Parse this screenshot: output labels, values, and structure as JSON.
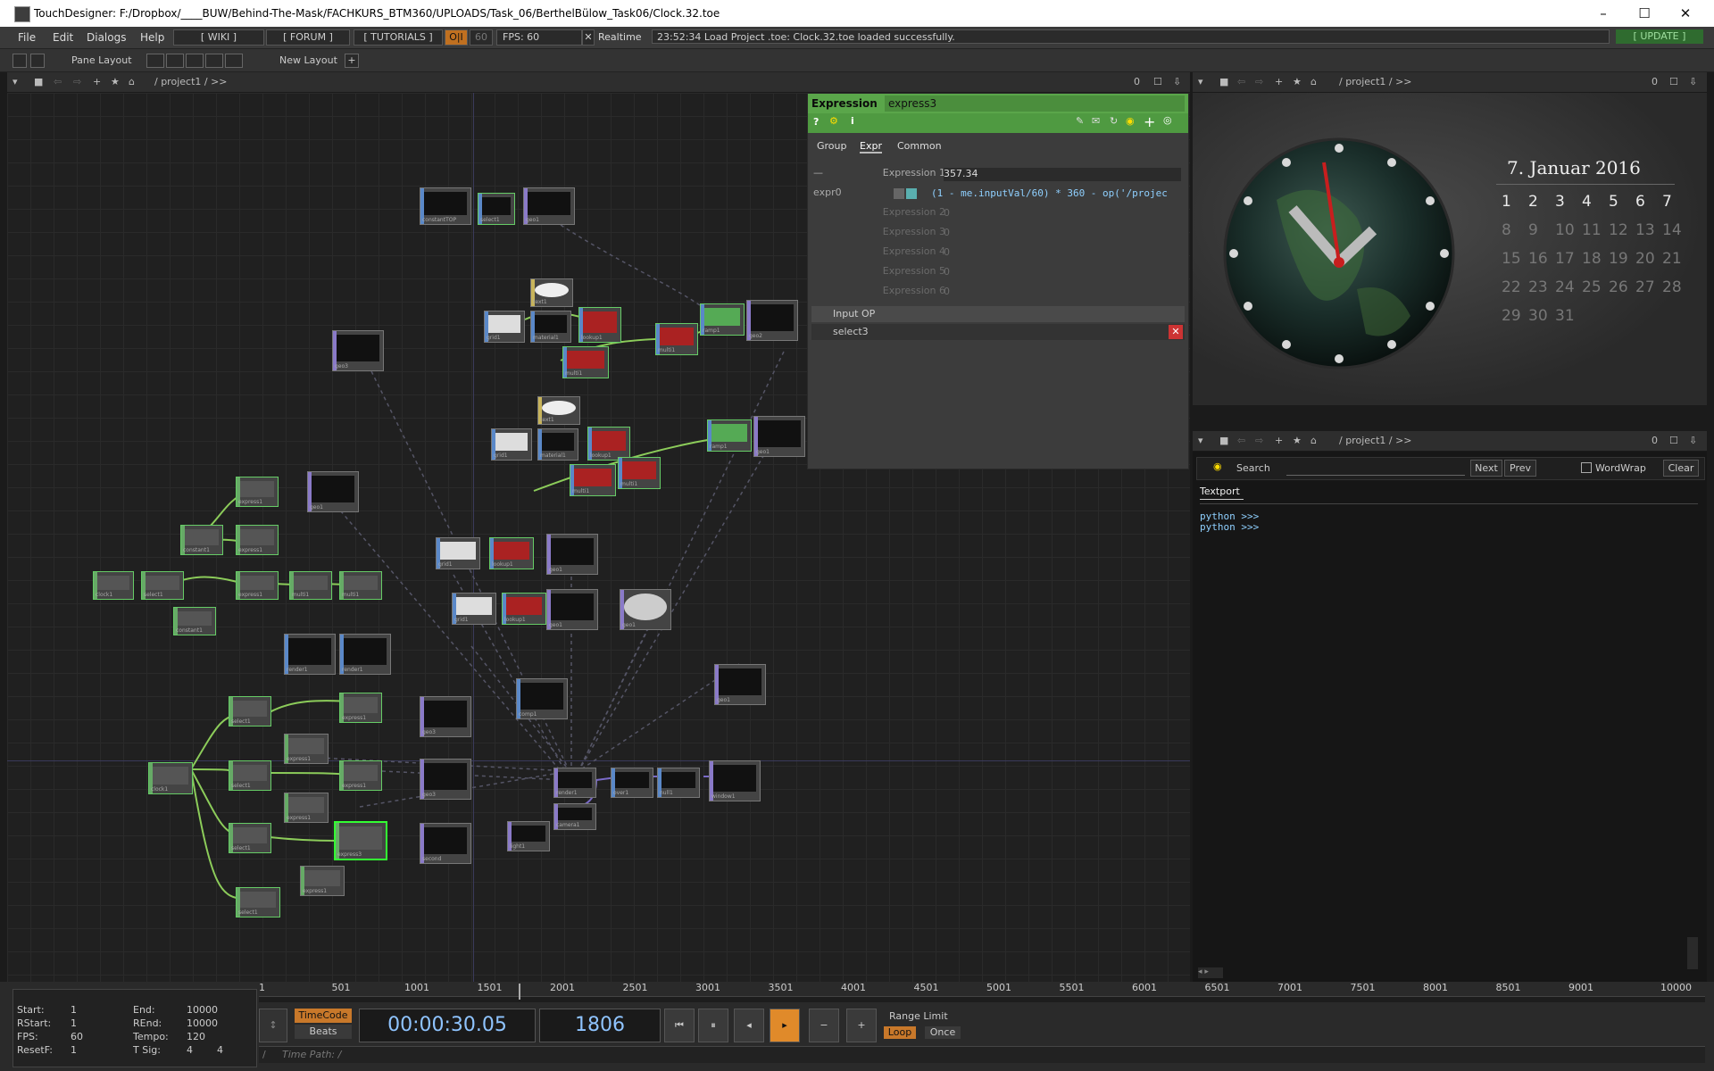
{
  "window": {
    "title": "TouchDesigner: F:/Dropbox/____BUW/Behind-The-Mask/FACHKURS_BTM360/UPLOADS/Task_06/BerthelBülow_Task06/Clock.32.toe",
    "minimize": "–",
    "maximize": "☐",
    "close": "✕"
  },
  "menu": {
    "items": [
      "File",
      "Edit",
      "Dialogs",
      "Help"
    ],
    "wiki": "[ WIKI ]",
    "forum": "[ FORUM ]",
    "tutorials": "[ TUTORIALS ]",
    "oi": "O|I",
    "fps_cap": "60",
    "fps": "FPS:  60",
    "realtime": "Realtime",
    "status": "23:52:34 Load Project .toe: Clock.32.toe loaded successfully.",
    "update": "[ UPDATE ]"
  },
  "layoutbar": {
    "pane_layout": "Pane Layout",
    "new_layout": "New Layout"
  },
  "network_path": {
    "path": "/ project1 / >>",
    "zero": "0"
  },
  "viewer_path": {
    "path": "/ project1 / >>",
    "zero": "0"
  },
  "textport_path": {
    "path": "/ project1 / >>",
    "zero": "0"
  },
  "params": {
    "type": "Expression",
    "name": "express3",
    "tabs": [
      "Group",
      "Expr",
      "Common"
    ],
    "rows": [
      {
        "label": "Expression 1",
        "value": "357.34"
      },
      {
        "label": "expr0",
        "value": "(1 - me.inputVal/60) * 360 - op('/projec"
      },
      {
        "label": "Expression 2",
        "value": "0"
      },
      {
        "label": "Expression 3",
        "value": "0"
      },
      {
        "label": "Expression 4",
        "value": "0"
      },
      {
        "label": "Expression 5",
        "value": "0"
      },
      {
        "label": "Expression 6",
        "value": "0"
      }
    ],
    "input_op_label": "Input OP",
    "input_op_value": "select3"
  },
  "calendar": {
    "title": "7. Januar 2016",
    "rows": [
      [
        "1",
        "2",
        "3",
        "4",
        "5",
        "6",
        "7"
      ],
      [
        "8",
        "9",
        "10",
        "11",
        "12",
        "13",
        "14"
      ],
      [
        "15",
        "16",
        "17",
        "18",
        "19",
        "20",
        "21"
      ],
      [
        "22",
        "23",
        "24",
        "25",
        "26",
        "27",
        "28"
      ],
      [
        "29",
        "30",
        "31"
      ]
    ]
  },
  "textport": {
    "search_label": "Search",
    "next": "Next",
    "prev": "Prev",
    "wordwrap": "WordWrap",
    "clear": "Clear",
    "tab": "Textport",
    "lines": [
      "python >>>",
      "python >>>"
    ]
  },
  "timeline": {
    "ticks": [
      "1",
      "501",
      "1001",
      "1501",
      "2001",
      "2501",
      "3001",
      "3501",
      "4001",
      "4501",
      "5001",
      "5501",
      "6001",
      "6501",
      "7001",
      "7501",
      "8001",
      "8501",
      "9001",
      "10000"
    ],
    "info": {
      "start_label": "Start:",
      "start": "1",
      "end_label": "End:",
      "end": "10000",
      "rstart_label": "RStart:",
      "rstart": "1",
      "rend_label": "REnd:",
      "rend": "10000",
      "fps_label": "FPS:",
      "fps": "60",
      "tempo_label": "Tempo:",
      "tempo": "120",
      "resetf_label": "ResetF:",
      "resetf": "1",
      "tsig_label": "T Sig:",
      "tsig1": "4",
      "tsig2": "4"
    },
    "timecode": "TimeCode",
    "beats": "Beats",
    "time": "00:00:30.05",
    "frame": "1806",
    "range_limit": "Range Limit",
    "loop": "Loop",
    "once": "Once",
    "time_path": "Time Path: /",
    "slash": "/"
  },
  "nodes": [
    {
      "label": "constantTOP",
      "kind": "top"
    },
    {
      "label": "select1",
      "kind": "top"
    },
    {
      "label": "geo1",
      "kind": "comp"
    },
    {
      "label": "text1",
      "kind": "dat"
    },
    {
      "label": "grid1",
      "kind": "sop"
    },
    {
      "label": "material1",
      "kind": "top"
    },
    {
      "label": "lookup1",
      "kind": "top"
    },
    {
      "label": "ramp1",
      "kind": "top"
    },
    {
      "label": "geo2",
      "kind": "comp"
    },
    {
      "label": "constant1",
      "kind": "top"
    },
    {
      "label": "geo3",
      "kind": "comp"
    },
    {
      "label": "multi1",
      "kind": "top"
    },
    {
      "label": "express1",
      "kind": "chop"
    },
    {
      "label": "comp1",
      "kind": "top"
    },
    {
      "label": "clock1",
      "kind": "chop"
    },
    {
      "label": "render1",
      "kind": "top"
    },
    {
      "label": "over1",
      "kind": "top"
    },
    {
      "label": "null1",
      "kind": "top"
    },
    {
      "label": "window1",
      "kind": "comp"
    },
    {
      "label": "camera1",
      "kind": "comp"
    },
    {
      "label": "light1",
      "kind": "comp"
    },
    {
      "label": "express3",
      "kind": "chop"
    },
    {
      "label": "second",
      "kind": "comp"
    }
  ],
  "colors": {
    "param_header": "#5aa64a",
    "selected_node": "#33ff33",
    "timecode_active": "#c8782a",
    "play_active": "#e08a2a"
  }
}
